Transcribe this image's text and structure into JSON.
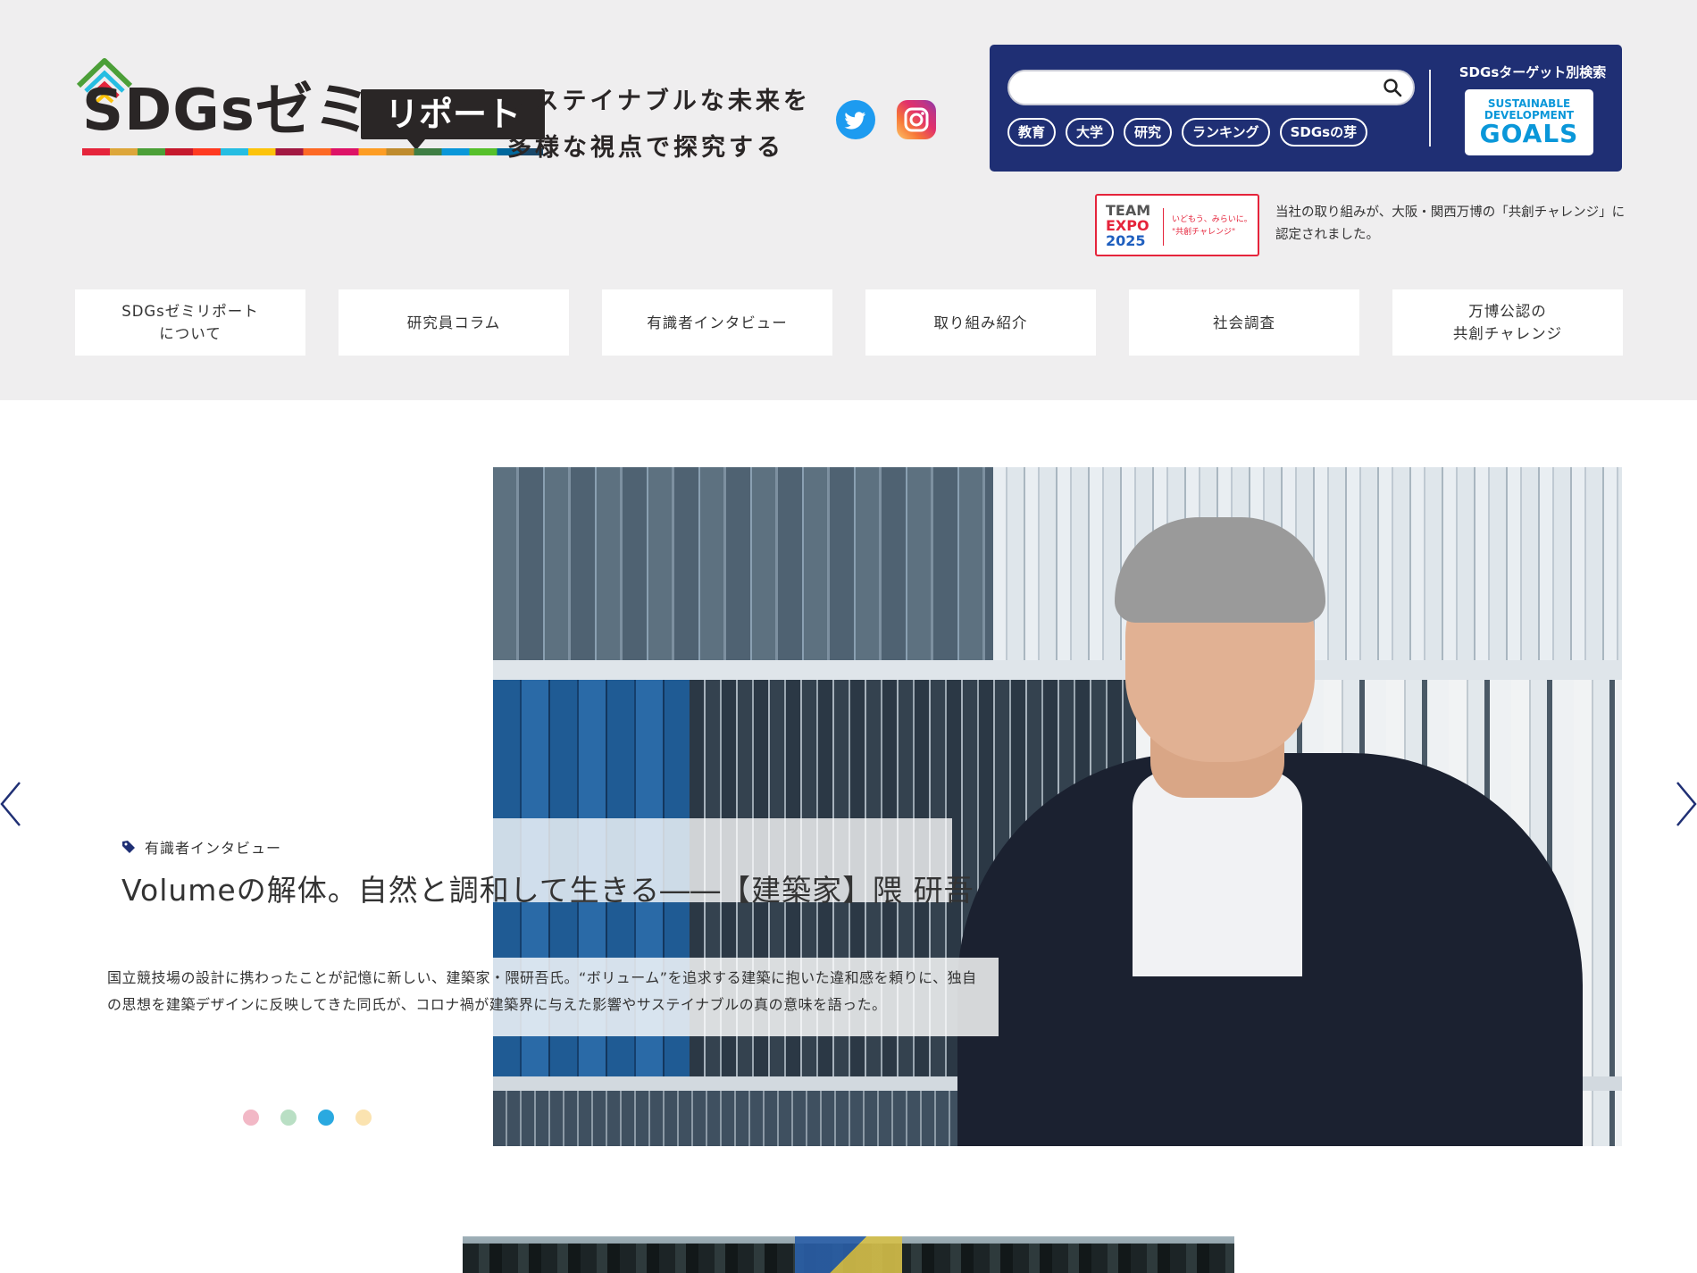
{
  "header": {
    "logo": {
      "main": "SDGsゼミ",
      "badge": "リポート"
    },
    "tagline": [
      "サステイナブルな未来を",
      "多様な視点で探究する"
    ],
    "social": [
      {
        "name": "twitter-icon"
      },
      {
        "name": "instagram-icon"
      }
    ]
  },
  "search": {
    "placeholder": "",
    "tags": [
      "教育",
      "大学",
      "研究",
      "ランキング",
      "SDGsの芽"
    ],
    "target_label": "SDGsターゲット別検索",
    "goals_small_1": "SUSTAINABLE",
    "goals_small_2": "DEVELOPMENT",
    "goals_big": "GOALS"
  },
  "expo": {
    "line1": "TEAM",
    "line2": "EXPO",
    "line3": "2025",
    "sub1": "いどもう、みらいに。",
    "sub2": "\"共創チャレンジ\"",
    "note": "当社の取り組みが、大阪・関西万博の「共創チャレンジ」に認定されました。"
  },
  "nav": [
    {
      "line1": "SDGsゼミリポート",
      "line2": "について"
    },
    {
      "line1": "研究員コラム",
      "line2": ""
    },
    {
      "line1": "有識者インタビュー",
      "line2": ""
    },
    {
      "line1": "取り組み紹介",
      "line2": ""
    },
    {
      "line1": "社会調査",
      "line2": ""
    },
    {
      "line1": "万博公認の",
      "line2": "共創チャレンジ"
    }
  ],
  "hero": {
    "category": "有識者インタビュー",
    "title": "Volumeの解体。自然と調和して生きる――【建築家】隈 研吾",
    "description": "国立競技場の設計に携わったことが記憶に新しい、建築家・隈研吾氏。“ボリューム”を追求する建築に抱いた違和感を頼りに、独自の思想を建築デザインに反映してきた同氏が、コロナ禍が建築界に与えた影響やサステイナブルの真の意味を語った。",
    "dots": [
      {
        "color": "#f2b8c6",
        "active": false
      },
      {
        "color": "#b9dfc4",
        "active": false
      },
      {
        "color": "#2aa9e0",
        "active": true
      },
      {
        "color": "#fbe3b0",
        "active": false
      }
    ]
  },
  "colors": {
    "header_bg": "#efeeef",
    "panel_bg": "#1f2f74",
    "goals_blue": "#0a97d9",
    "expo_red": "#e5243b"
  }
}
